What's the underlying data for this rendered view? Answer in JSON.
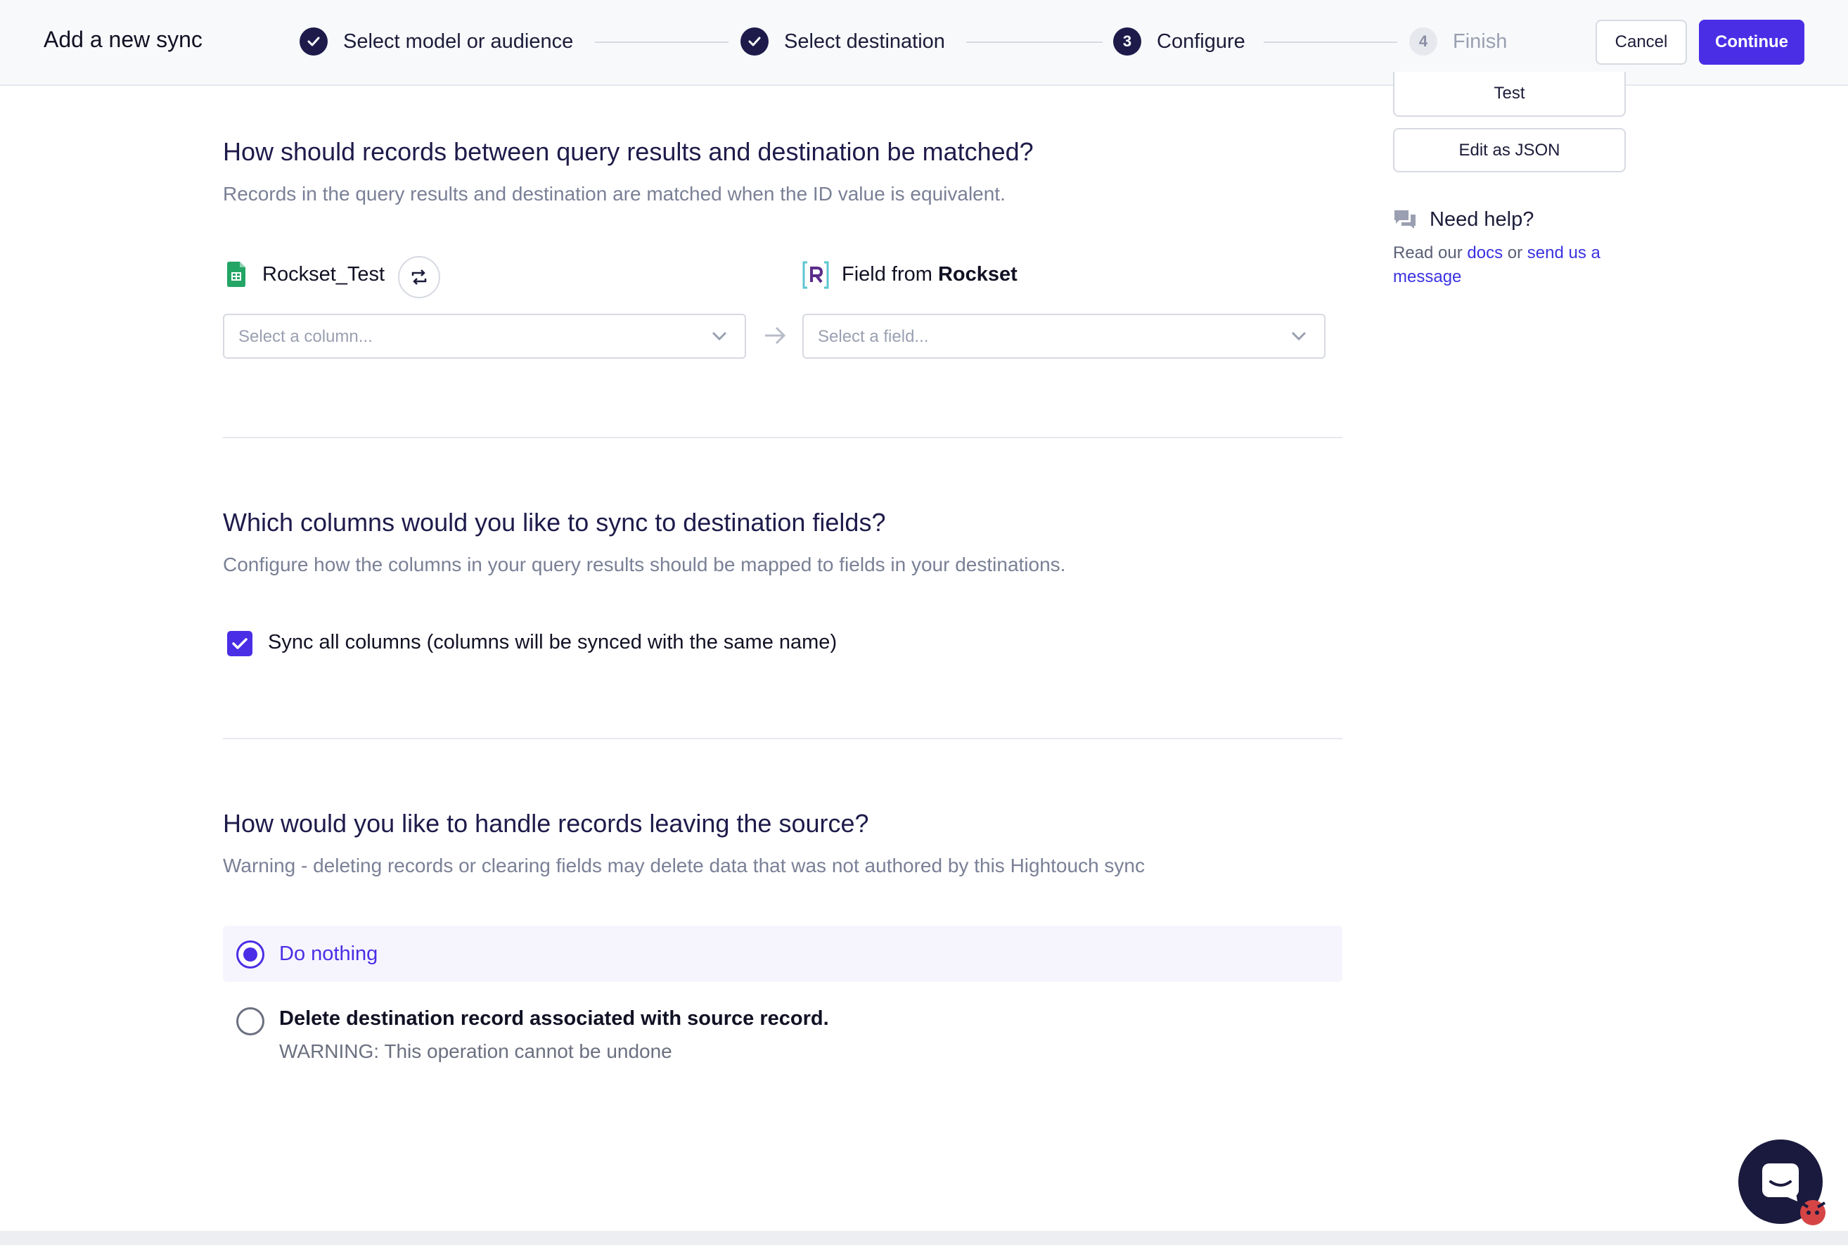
{
  "header": {
    "title": "Add a new sync",
    "steps": [
      {
        "label": "Select model or audience",
        "state": "done"
      },
      {
        "label": "Select destination",
        "state": "done"
      },
      {
        "number": "3",
        "label": "Configure",
        "state": "active"
      },
      {
        "number": "4",
        "label": "Finish",
        "state": "pending"
      }
    ],
    "cancel_label": "Cancel",
    "continue_label": "Continue"
  },
  "sidebar": {
    "test_label": "Test",
    "json_label": "Edit as JSON",
    "help_title": "Need help?",
    "help_text_prefix": "Read our ",
    "docs_link": "docs",
    "help_text_middle": " or ",
    "message_link": "send us a message"
  },
  "match_section": {
    "title": "How should records between query results and destination be matched?",
    "subtitle": "Records in the query results and destination are matched when the ID value is equivalent.",
    "source_name": "Rockset_Test",
    "dest_prefix": "Field from ",
    "dest_name": "Rockset",
    "column_placeholder": "Select a column...",
    "field_placeholder": "Select a field..."
  },
  "columns_section": {
    "title": "Which columns would you like to sync to destination fields?",
    "subtitle": "Configure how the columns in your query results should be mapped to fields in your destinations.",
    "sync_all_label": "Sync all columns (columns will be synced with the same name)",
    "sync_all_checked": true
  },
  "leaving_section": {
    "title": "How would you like to handle records leaving the source?",
    "subtitle": "Warning - deleting records or clearing fields may delete data that was not authored by this Hightouch sync",
    "option_nothing": "Do nothing",
    "option_delete": "Delete destination record associated with source record.",
    "option_delete_warning": "WARNING: This operation cannot be undone",
    "selected": "nothing"
  },
  "colors": {
    "accent": "#4a2ee6",
    "step_dark": "#1e1b4b"
  }
}
